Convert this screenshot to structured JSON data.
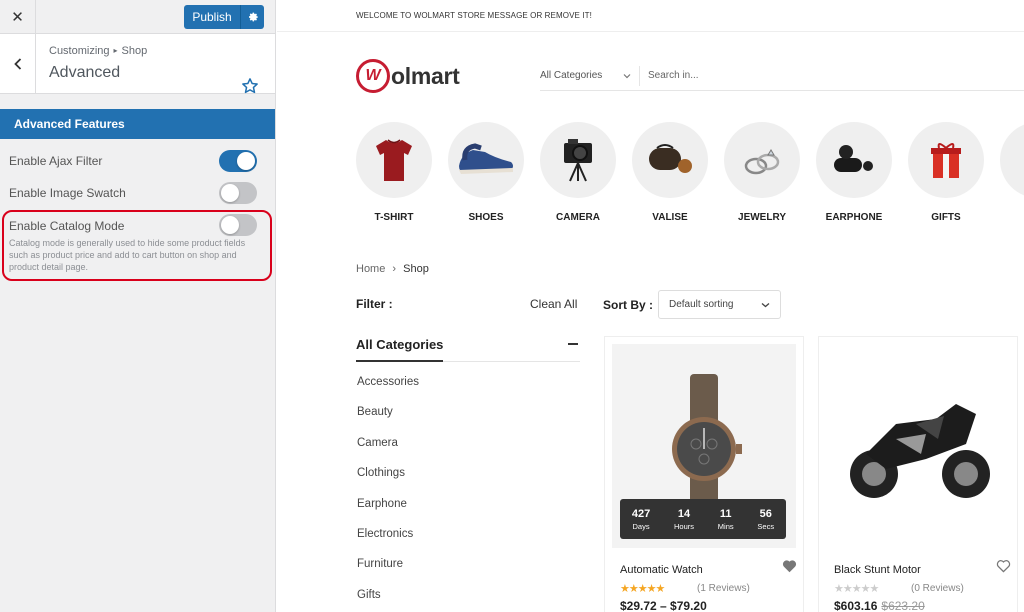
{
  "customizer": {
    "publish_label": "Publish",
    "breadcrumb": {
      "root": "Customizing",
      "section": "Shop"
    },
    "section_title": "Advanced",
    "group_title": "Advanced Features",
    "options": [
      {
        "label": "Enable Ajax Filter",
        "enabled": true
      },
      {
        "label": "Enable Image Swatch",
        "enabled": false
      },
      {
        "label": "Enable Catalog Mode",
        "enabled": false
      }
    ],
    "catalog_description": "Catalog mode is generally used to hide some product fields such as product price and add to cart button on shop and product detail page.",
    "colors": {
      "accent": "#2271b1",
      "highlight": "#d9001b"
    }
  },
  "store": {
    "welcome": "WELCOME TO WOLMART STORE MESSAGE OR REMOVE IT!",
    "logo_text": "olmart",
    "logo_letter": "W",
    "search": {
      "category": "All Categories",
      "placeholder": "Search in..."
    },
    "categories": [
      "T-SHIRT",
      "SHOES",
      "CAMERA",
      "VALISE",
      "JEWELRY",
      "EARPHONE",
      "GIFTS"
    ],
    "breadcrumb": {
      "home": "Home",
      "current": "Shop"
    },
    "filter_label": "Filter :",
    "clean_all": "Clean All",
    "sort_label": "Sort By :",
    "sort_value": "Default sorting",
    "all_categories_title": "All Categories",
    "category_list": [
      "Accessories",
      "Beauty",
      "Camera",
      "Clothings",
      "Earphone",
      "Electronics",
      "Furniture",
      "Gifts"
    ],
    "products": [
      {
        "name": "Automatic Watch",
        "reviews": "(1 Reviews)",
        "price": "$29.72 – $79.20",
        "old_price": "",
        "rating": 5,
        "countdown": [
          {
            "n": "427",
            "l": "Days"
          },
          {
            "n": "14",
            "l": "Hours"
          },
          {
            "n": "11",
            "l": "Mins"
          },
          {
            "n": "56",
            "l": "Secs"
          }
        ]
      },
      {
        "name": "Black Stunt Motor",
        "reviews": "(0 Reviews)",
        "price": "$603.16",
        "old_price": "$623.20",
        "rating": 0
      }
    ],
    "colors": {
      "brand": "#c61d32",
      "star": "#f5a623"
    }
  }
}
